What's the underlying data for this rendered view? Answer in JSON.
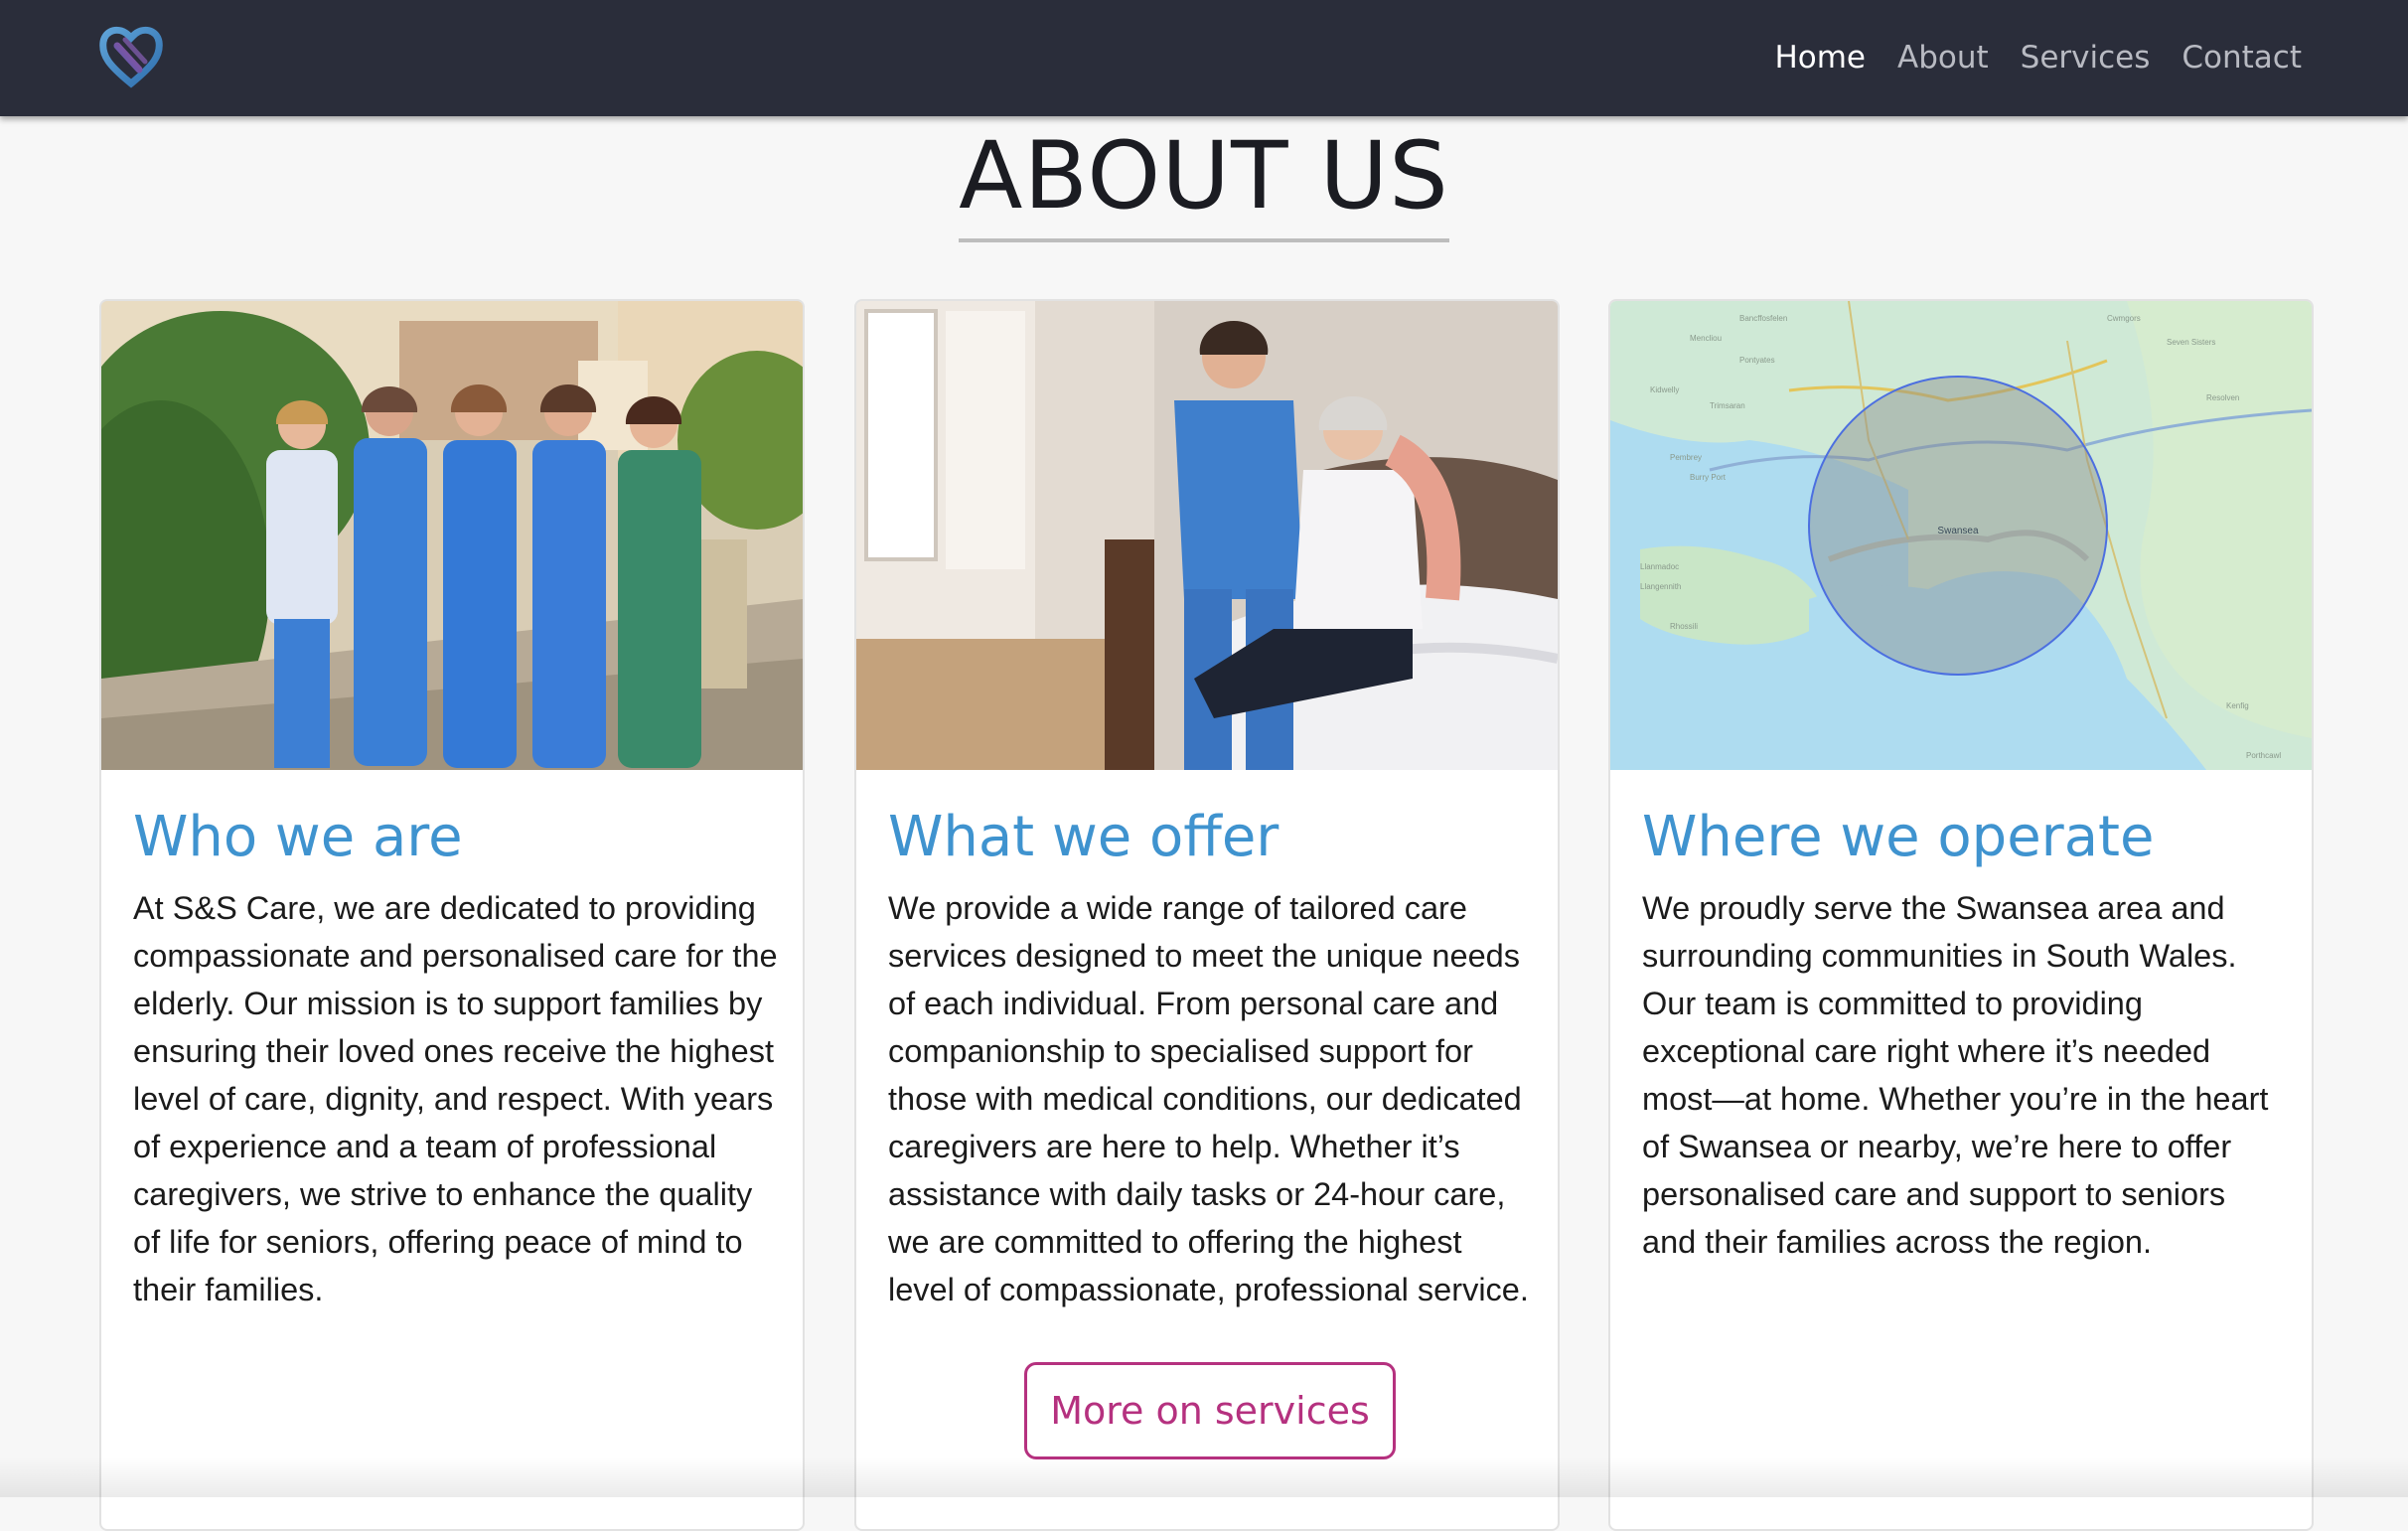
{
  "nav": {
    "links": [
      {
        "label": "Home",
        "active": true
      },
      {
        "label": "About",
        "active": false
      },
      {
        "label": "Services",
        "active": false
      },
      {
        "label": "Contact",
        "active": false
      }
    ]
  },
  "page": {
    "title": "ABOUT US"
  },
  "cards": [
    {
      "title": "Who we are",
      "text": "At S&S Care, we are dedicated to providing compassionate and personalised care for the elderly. Our mission is to support families by ensuring their loved ones receive the highest level of care, dignity, and respect. With years of experience and a team of professional caregivers, we strive to enhance the quality of life for seniors, offering peace of mind to their families."
    },
    {
      "title": "What we offer",
      "text": "We provide a wide range of tailored care services designed to meet the unique needs of each individual. From personal care and companionship to specialised support for those with medical conditions, our dedicated caregivers are here to help. Whether it’s assistance with daily tasks or 24-hour care, we are committed to offering the highest level of compassionate, professional service.",
      "button_label": "More on services"
    },
    {
      "title": "Where we operate",
      "text": "We proudly serve the Swansea area and surrounding communities in South Wales. Our team is committed to providing exceptional care right where it’s needed most—at home. Whether you’re in the heart of Swansea or nearby, we’re here to offer personalised care and support to seniors and their families across the region.",
      "map_label": "Swansea"
    }
  ],
  "colors": {
    "navbar": "#2a2d3a",
    "heading_blue": "#3f93cf",
    "button_accent": "#b5317f",
    "page_background": "#f7f7f7"
  },
  "icons": {
    "logo": "heart-logo-icon"
  }
}
